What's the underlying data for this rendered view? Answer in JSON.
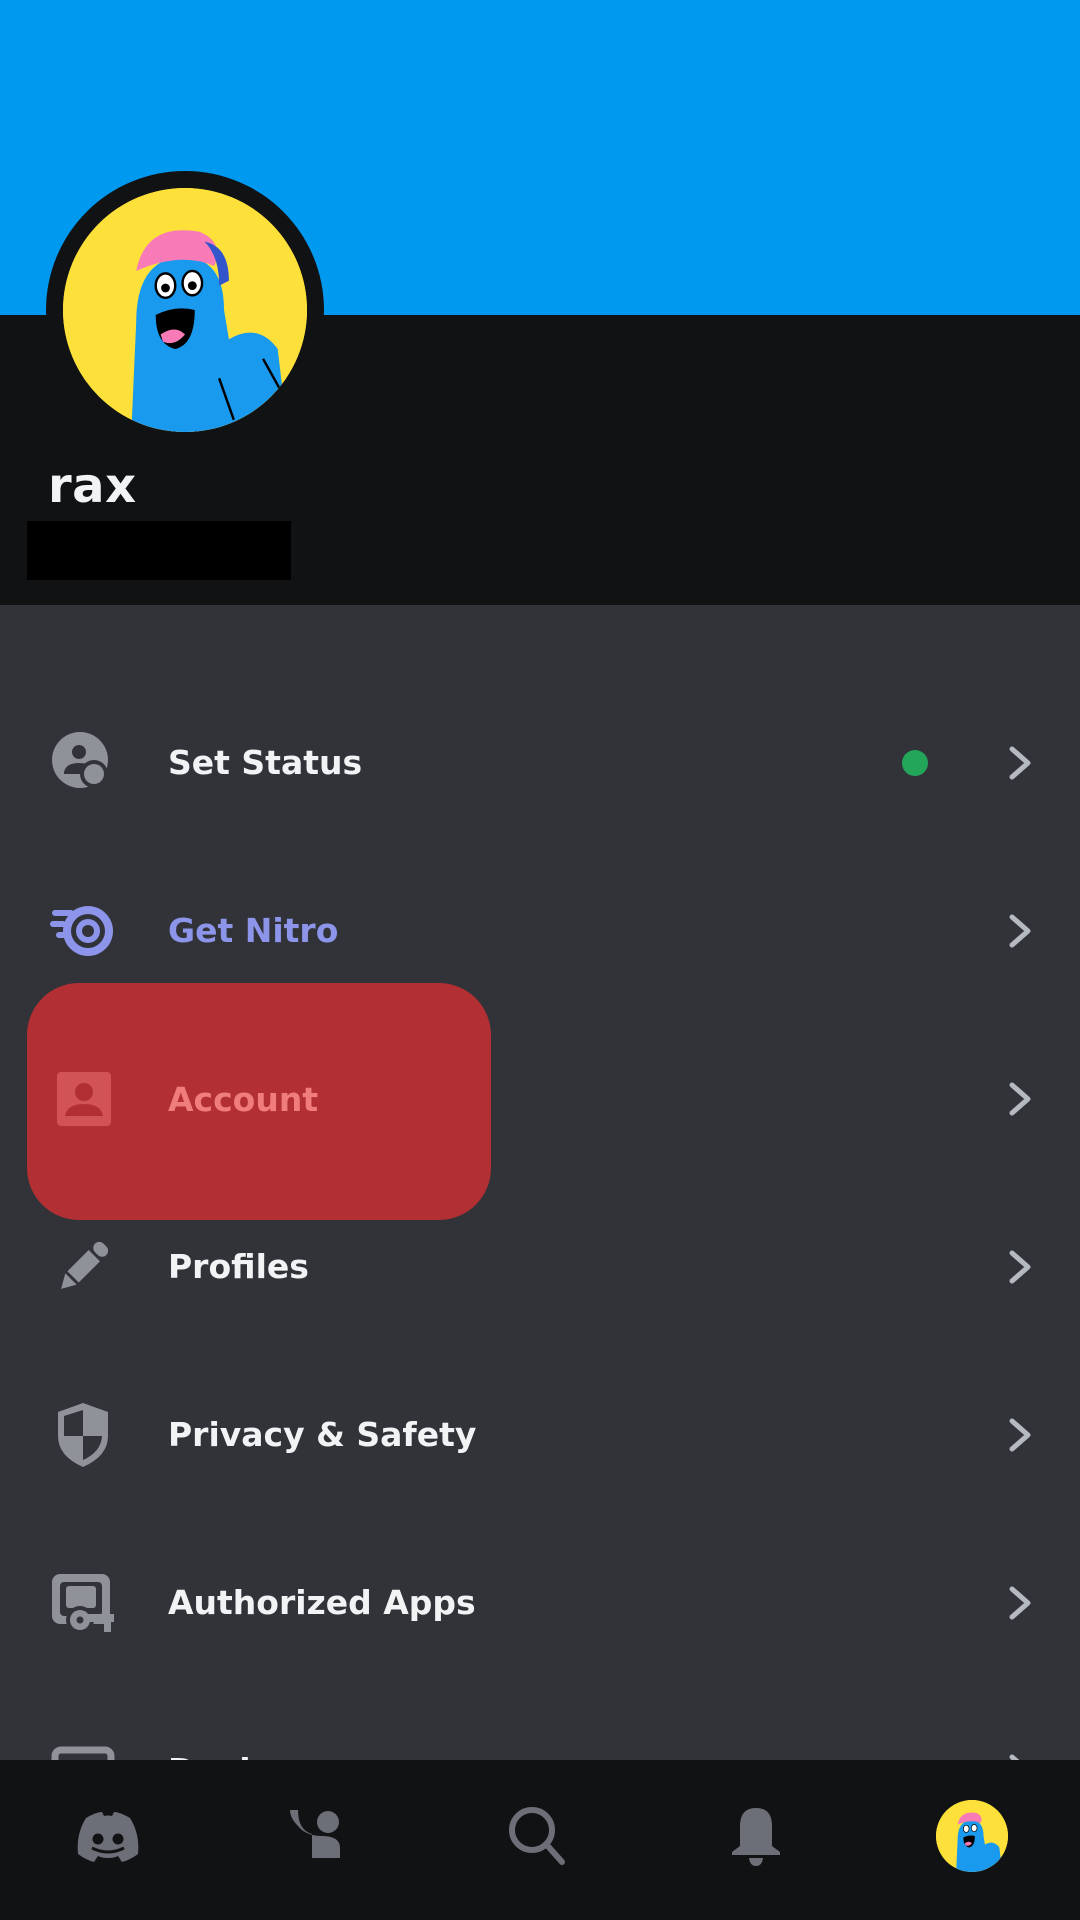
{
  "profile": {
    "username": "rax",
    "banner_color": "#0099f0",
    "avatar": "cartoon-blue-character-avatar"
  },
  "menu": {
    "items": [
      {
        "label": "Set Status",
        "icon": "status-person-icon",
        "status": "online",
        "status_color": "#23a55a"
      },
      {
        "label": "Get Nitro",
        "icon": "nitro-icon",
        "color": "#8c95ea"
      },
      {
        "label": "Account",
        "icon": "account-card-icon",
        "highlighted": true,
        "highlight_color": "#b22f33"
      },
      {
        "label": "Profiles",
        "icon": "pencil-icon"
      },
      {
        "label": "Privacy & Safety",
        "icon": "shield-icon"
      },
      {
        "label": "Authorized Apps",
        "icon": "app-key-icon"
      },
      {
        "label": "Devices",
        "icon": "device-icon",
        "partially_visible": true
      }
    ]
  },
  "bottom_nav": {
    "items": [
      {
        "name": "home",
        "icon": "discord-logo-icon"
      },
      {
        "name": "friends",
        "icon": "friends-wave-icon"
      },
      {
        "name": "search",
        "icon": "search-icon"
      },
      {
        "name": "notifications",
        "icon": "bell-icon"
      },
      {
        "name": "you",
        "icon": "profile-avatar",
        "active": true
      }
    ]
  }
}
